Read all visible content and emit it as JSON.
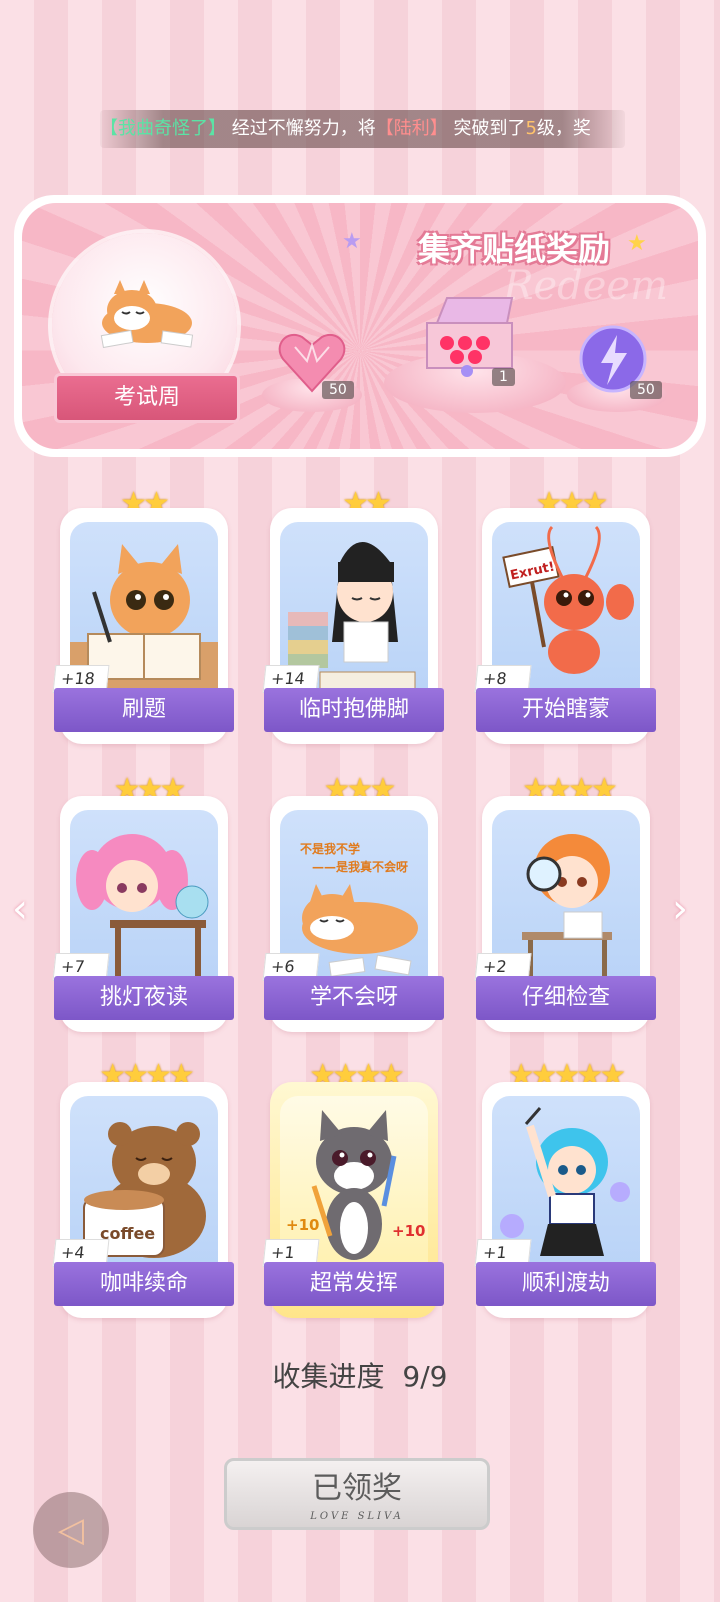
{
  "marquee": {
    "prefix": "【",
    "name": "我曲奇怪了",
    "suffix": "】",
    "text1": " 经过不懈努力，将",
    "target_open": "【",
    "target": "陆利",
    "target_close": "】",
    "text2": " 突破到了",
    "level": "5",
    "text3": "级，奖"
  },
  "reward_panel": {
    "title": "集齐贴纸奖励",
    "watermark": "Redeem",
    "theme_label": "考试周",
    "rewards": [
      {
        "icon": "heart-gem-icon",
        "count": "50"
      },
      {
        "icon": "gift-box-icon",
        "count": "1"
      },
      {
        "icon": "lightning-orb-icon",
        "count": "50"
      }
    ]
  },
  "stickers": [
    {
      "name": "刷题",
      "score": "+18",
      "stars": "★★",
      "art": "cat-studying-art"
    },
    {
      "name": "临时抱佛脚",
      "score": "+14",
      "stars": "★★",
      "art": "girl-with-books-art"
    },
    {
      "name": "开始瞎蒙",
      "score": "+8",
      "stars": "★★★",
      "art": "shrimp-with-sign-art",
      "sign": "Exrut!"
    },
    {
      "name": "挑灯夜读",
      "score": "+7",
      "stars": "★★★",
      "art": "pink-hair-girl-desk-art"
    },
    {
      "name": "学不会呀",
      "score": "+6",
      "stars": "★★★",
      "art": "shiba-lying-art",
      "caption1": "不是我不学",
      "caption2": "——是我真不会呀"
    },
    {
      "name": "仔细检查",
      "score": "+2",
      "stars": "★★★★",
      "art": "orange-hair-girl-magnifier-art"
    },
    {
      "name": "咖啡续命",
      "score": "+4",
      "stars": "★★★★",
      "art": "bear-coffee-art",
      "cup": "coffee"
    },
    {
      "name": "超常发挥",
      "score": "+1",
      "stars": "★★★★",
      "art": "cat-pencils-art",
      "bonus": "+10"
    },
    {
      "name": "顺利渡劫",
      "score": "+1",
      "stars": "★★★★★",
      "art": "blue-hair-girl-pen-art"
    }
  ],
  "progress": {
    "label": "收集进度",
    "value": "9/9"
  },
  "claim_button": {
    "label": "已领奖",
    "sub": "LOVE SLIVA"
  },
  "colors": {
    "card_label": "#8a63d2",
    "panel_pink": "#f7b7c6",
    "star": "#ffcd3c"
  }
}
